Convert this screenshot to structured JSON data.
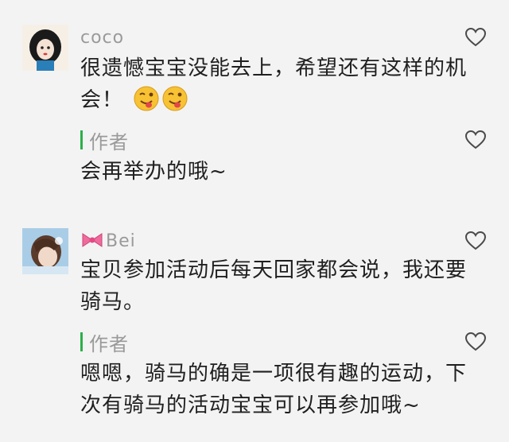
{
  "comments": [
    {
      "nickname": "coco",
      "text": "很遗憾宝宝没能去上，希望还有这样的机会！",
      "reply_label": "作者",
      "reply_text": "会再举办的哦~"
    },
    {
      "nickname": "Bei",
      "text": "宝贝参加活动后每天回家都会说，我还要骑马。",
      "reply_label": "作者",
      "reply_text": "嗯嗯，骑马的确是一项很有趣的运动，下次有骑马的活动宝宝可以再参加哦~"
    }
  ],
  "colors": {
    "background": "#f3f3f3",
    "author_bar": "#2bb04a",
    "muted_text": "#9a9a9a",
    "body_text": "#1f1f1f"
  },
  "icons": [
    "heart-outline-icon",
    "tongue-wink-emoji",
    "bow-emoji"
  ]
}
